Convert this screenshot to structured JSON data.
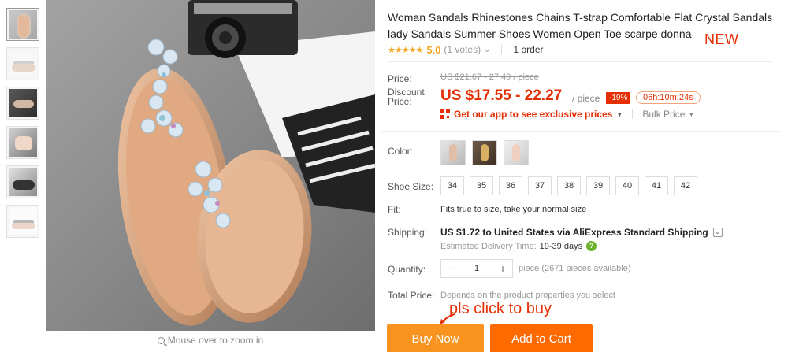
{
  "thumbnails": [
    "thumb1",
    "thumb2",
    "thumb3",
    "thumb4",
    "thumb5",
    "thumb6"
  ],
  "main_image": {
    "zoom_hint": "Mouse over to zoom in"
  },
  "product": {
    "title": "Woman Sandals Rhinestones Chains T-strap Comfortable Flat Crystal Sandals lady Sandals Summer Shoes Women Open Toe scarpe donna",
    "new_tag": "NEW",
    "rating": {
      "stars": "★★★★★",
      "score": "5.0",
      "votes": "(1 votes)",
      "orders": "1 order"
    }
  },
  "price": {
    "label": "Price:",
    "original": "US $21.67 - 27.49 / piece",
    "discount_label": "Discount Price:",
    "discount_price": "US $17.55 - 22.27",
    "per_piece": "/ piece",
    "discount_pct": "-19%",
    "timer": "06h:10m:24s",
    "app_link": "Get our app to see exclusive prices",
    "bulk_price": "Bulk Price"
  },
  "color": {
    "label": "Color:"
  },
  "shoe_size": {
    "label": "Shoe Size:",
    "sizes": [
      "34",
      "35",
      "36",
      "37",
      "38",
      "39",
      "40",
      "41",
      "42"
    ]
  },
  "fit": {
    "label": "Fit:",
    "text": "Fits true to size, take your normal size"
  },
  "shipping": {
    "label": "Shipping:",
    "text": "US $1.72 to United States via AliExpress Standard Shipping",
    "est_label": "Estimated Delivery Time:",
    "est_days": "19-39 days"
  },
  "quantity": {
    "label": "Quantity:",
    "value": "1",
    "note": "piece (2671 pieces available)"
  },
  "total": {
    "label": "Total Price:",
    "text": "Depends on the product properties you select"
  },
  "annotation": "pls click to buy",
  "buttons": {
    "buy_now": "Buy Now",
    "add_to_cart": "Add to Cart"
  },
  "colors": {
    "accent": "#e62e04",
    "buy": "#f7931e",
    "cart": "#ff6a00",
    "star": "#f5a623"
  }
}
